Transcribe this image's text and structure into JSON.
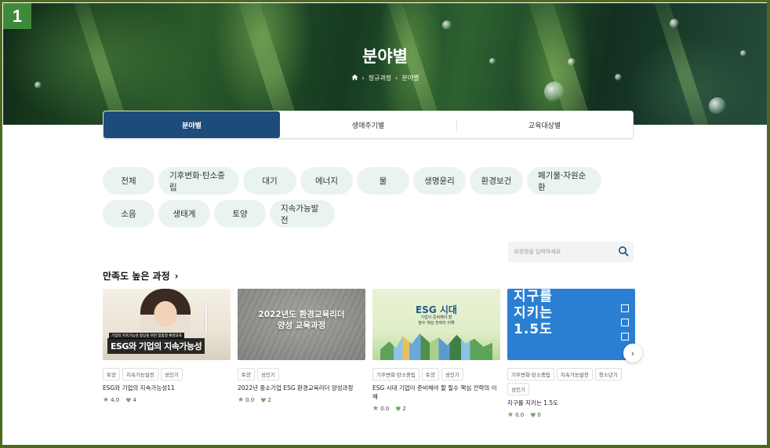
{
  "badge": "1",
  "hero": {
    "title": "분야별",
    "breadcrumb": [
      "정규과정",
      "분야별"
    ]
  },
  "tabs": [
    {
      "label": "분야별",
      "active": true
    },
    {
      "label": "생애주기별",
      "active": false
    },
    {
      "label": "교육대상별",
      "active": false
    }
  ],
  "categories": [
    "전체",
    "기후변화·탄소중립",
    "대기",
    "에너지",
    "물",
    "생명윤리",
    "환경보건",
    "폐기물·자원순환",
    "소음",
    "생태계",
    "토양",
    "지속가능발전"
  ],
  "search": {
    "placeholder": "과정명을 입력하세요"
  },
  "section_title": "만족도 높은 과정",
  "courses": [
    {
      "thumb_subtitle": "기업의 지속가능성 향상을 위한 맞춤형 환경교육",
      "thumb_caption": "ESG와 기업의 지속가능성",
      "tags": [
        "토양",
        "지속가능발전",
        "성인기"
      ],
      "title": "ESG와 기업의 지속가능성11",
      "rating": "4.0",
      "likes": "4"
    },
    {
      "thumb_caption_line1": "2022년도 환경교육리더",
      "thumb_caption_line2": "양성 교육과정",
      "tags": [
        "토양",
        "성인기"
      ],
      "title": "2022년 중소기업 ESG 환경교육리더 양성과정",
      "rating": "0.0",
      "likes": "2"
    },
    {
      "thumb_caption": "ESG 시대",
      "thumb_caption_line1": "기업이 준비해야 할",
      "thumb_caption_line2": "필수 핵심 전략의 이해",
      "tags": [
        "기후변화·탄소중립",
        "토양",
        "성인기"
      ],
      "title": "ESG 시대 기업이 준비해야 할 필수 핵심 전략의 이해",
      "rating": "0.0",
      "likes": "2"
    },
    {
      "thumb_caption_line1": "지구를",
      "thumb_caption_line2": "지키는",
      "thumb_caption_line3": "1.5도",
      "tags": [
        "기후변화·탄소중립",
        "지속가능발전",
        "청소년기",
        "성인기"
      ],
      "title": "지구를 지키는 1.5도",
      "rating": "0.0",
      "likes": "0"
    }
  ],
  "colors": {
    "accent": "#1d4b7a",
    "chip_bg": "#eaf4ee",
    "rating": "#6aaa5a"
  }
}
